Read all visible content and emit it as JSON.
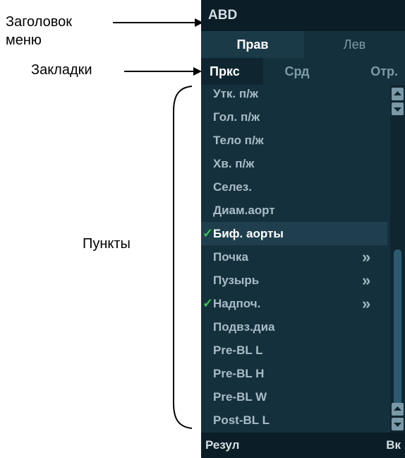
{
  "annotations": {
    "title_label_line1": "Заголовок",
    "title_label_line2": "меню",
    "tabs_label": "Закладки",
    "items_label": "Пункты"
  },
  "menu": {
    "title": "ABD",
    "side_tabs": [
      "Прав",
      "Лев"
    ],
    "tabs": [
      "Пркс",
      "Срд",
      "Отр."
    ],
    "items": [
      {
        "label": "Утк. п/ж",
        "checked": false,
        "submenu": false
      },
      {
        "label": "Гол. п/ж",
        "checked": false,
        "submenu": false
      },
      {
        "label": "Тело п/ж",
        "checked": false,
        "submenu": false
      },
      {
        "label": "Хв. п/ж",
        "checked": false,
        "submenu": false
      },
      {
        "label": "Селез.",
        "checked": false,
        "submenu": false
      },
      {
        "label": "Диам.аорт",
        "checked": false,
        "submenu": false
      },
      {
        "label": "Биф. аорты",
        "checked": true,
        "submenu": false,
        "selected": true
      },
      {
        "label": "Почка",
        "checked": false,
        "submenu": true
      },
      {
        "label": "Пузырь",
        "checked": false,
        "submenu": true
      },
      {
        "label": "Надпоч.",
        "checked": true,
        "submenu": true
      },
      {
        "label": "Подвз.диа",
        "checked": false,
        "submenu": false
      },
      {
        "label": "Pre-BL L",
        "checked": false,
        "submenu": false
      },
      {
        "label": "Pre-BL H",
        "checked": false,
        "submenu": false
      },
      {
        "label": "Pre-BL W",
        "checked": false,
        "submenu": false
      },
      {
        "label": "Post-BL L",
        "checked": false,
        "submenu": false
      }
    ],
    "check_glyph": "✓",
    "submenu_glyph": "»",
    "bottom_left": "Резул",
    "bottom_right": "Вк"
  },
  "colors": {
    "panel_bg": "#15303d",
    "title_bg": "#0b1e27",
    "check": "#38c24a"
  }
}
